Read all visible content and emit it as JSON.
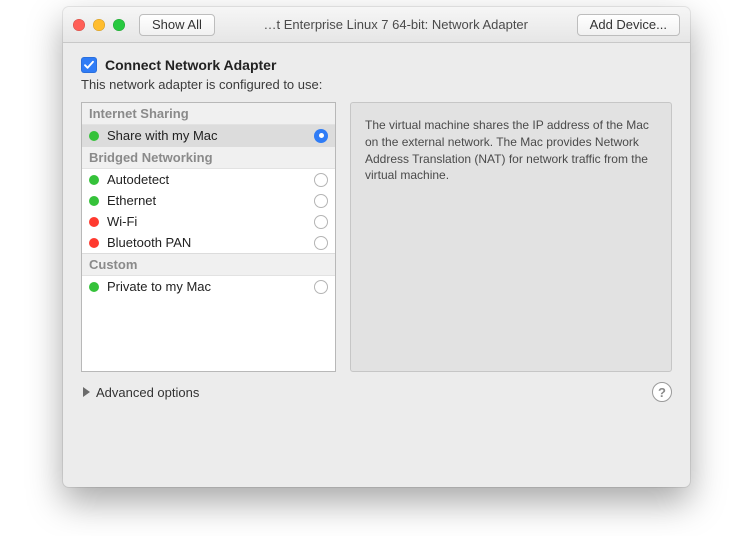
{
  "toolbar": {
    "show_all_label": "Show All",
    "title": "…t Enterprise Linux 7 64-bit: Network Adapter",
    "add_device_label": "Add Device..."
  },
  "connect": {
    "checkbox_checked": true,
    "label": "Connect Network Adapter"
  },
  "subtitle": "This network adapter is configured to use:",
  "groups": [
    {
      "header": "Internet Sharing",
      "items": [
        {
          "label": "Share with my Mac",
          "status": "green",
          "selected": true
        }
      ]
    },
    {
      "header": "Bridged Networking",
      "items": [
        {
          "label": "Autodetect",
          "status": "green",
          "selected": false
        },
        {
          "label": "Ethernet",
          "status": "green",
          "selected": false
        },
        {
          "label": "Wi-Fi",
          "status": "red",
          "selected": false
        },
        {
          "label": "Bluetooth PAN",
          "status": "red",
          "selected": false
        }
      ]
    },
    {
      "header": "Custom",
      "items": [
        {
          "label": "Private to my Mac",
          "status": "green",
          "selected": false
        }
      ]
    }
  ],
  "description": "The virtual machine shares the IP address of the Mac on the external network. The Mac provides Network Address Translation (NAT) for network traffic from the virtual machine.",
  "advanced_label": "Advanced options",
  "help_label": "?"
}
